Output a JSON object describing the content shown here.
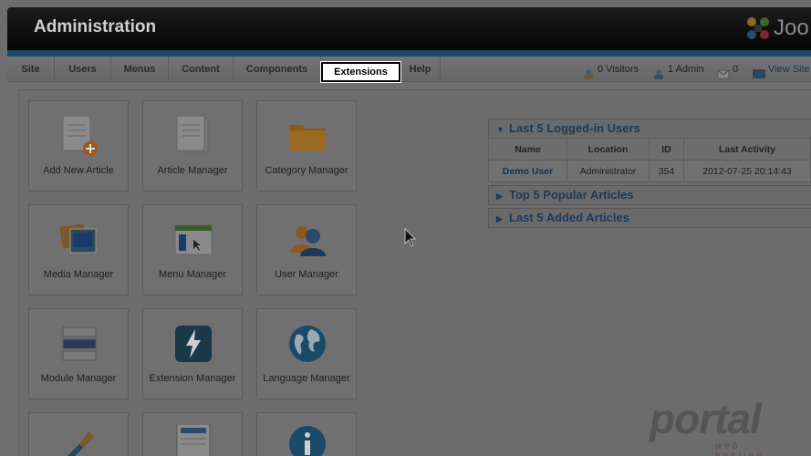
{
  "header": {
    "title": "Administration",
    "logo_text": "Joo"
  },
  "menu": {
    "items": [
      {
        "label": "Site"
      },
      {
        "label": "Users"
      },
      {
        "label": "Menus"
      },
      {
        "label": "Content"
      },
      {
        "label": "Components"
      },
      {
        "label": "Extensions"
      },
      {
        "label": "Help"
      }
    ],
    "status": {
      "visitors": "0 Visitors",
      "admins": "1 Admin",
      "messages": "0",
      "view_site": "View Site"
    }
  },
  "quick_icons": [
    {
      "label": "Add New Article",
      "icon": "add-article-icon"
    },
    {
      "label": "Article Manager",
      "icon": "article-manager-icon"
    },
    {
      "label": "Category Manager",
      "icon": "folder-icon"
    },
    {
      "label": "Media Manager",
      "icon": "media-icon"
    },
    {
      "label": "Menu Manager",
      "icon": "menu-manager-icon"
    },
    {
      "label": "User Manager",
      "icon": "users-icon"
    },
    {
      "label": "Module Manager",
      "icon": "module-icon"
    },
    {
      "label": "Extension Manager",
      "icon": "extension-icon"
    },
    {
      "label": "Language Manager",
      "icon": "globe-icon"
    },
    {
      "label": "",
      "icon": "tools-icon"
    },
    {
      "label": "",
      "icon": "template-icon"
    },
    {
      "label": "",
      "icon": "info-icon"
    }
  ],
  "modules": {
    "logged_in": {
      "title": "Last 5 Logged-in Users",
      "columns": [
        "Name",
        "Location",
        "ID",
        "Last Activity"
      ],
      "rows": [
        {
          "name": "Demo User",
          "location": "Administrator",
          "id": "354",
          "last_activity": "2012-07-25 20:14:43"
        }
      ]
    },
    "popular": {
      "title": "Top 5 Popular Articles"
    },
    "added": {
      "title": "Last 5 Added Articles"
    }
  },
  "watermark": {
    "text": "portal",
    "sub": "web hosting"
  }
}
